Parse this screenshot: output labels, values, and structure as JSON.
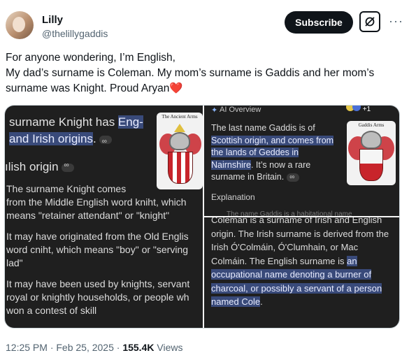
{
  "author": {
    "name": "Lilly",
    "handle": "@thelillygaddis"
  },
  "actions": {
    "subscribe": "Subscribe",
    "more": "···"
  },
  "tweet": {
    "text": "For anyone wondering, I’m English,\nMy dad’s surname is Coleman. My mom’s surname is Gaddis and her mom’s surname was Knight. Proud Aryan",
    "emoji": "❤️"
  },
  "media": {
    "left": {
      "title_pre": "surname Knight has ",
      "title_hl1": "Eng-",
      "title_hl2": "and Irish origins",
      "title_post": ".",
      "subheading": "ılish origin",
      "para1": "The surname Knight comes\nfrom the Middle English word kniht, which\nmeans \"retainer attendant\" or \"knight\"",
      "para2": "It may have originated from the Old Englis\nword cniht, which means \"boy\" or \"serving\nlad\"",
      "para3": "It may have been used by knights, servant\nroyal or knightly households, or people wh\nwon a contest of skill",
      "coa_header": "The Ancient Arms"
    },
    "top_right": {
      "header": "AI Overview",
      "icon_label": "+1",
      "text_pre": "The last name Gaddis is of ",
      "text_hl": "Scottish origin, and comes from the lands of Geddes in Nairnshire",
      "text_post": ". It’s now a rare surname in Britain.",
      "explanation": "Explanation",
      "explanation_sub": "The name Gaddis is a habitational name",
      "coa_header": "Gaddis Arms"
    },
    "bottom_right": {
      "text_pre": "Coleman is a surname of Irish and English origin. The Irish surname is derived from the Irish Ó'Colmáin, Ó'Clumhain, or Mac Colmáin. The English surname is ",
      "text_hl": "an occupational name denoting a burner of charcoal, or possibly a servant of a person named Cole",
      "text_post": "."
    }
  },
  "footer": {
    "time": "12:25 PM · Feb 25, 2025 · ",
    "views": "155.4K",
    "views_label": " Views"
  },
  "colors": {
    "accent_highlight": "#394a7a",
    "panel_bg": "#1f1f1f",
    "heart": "#f4212e"
  }
}
